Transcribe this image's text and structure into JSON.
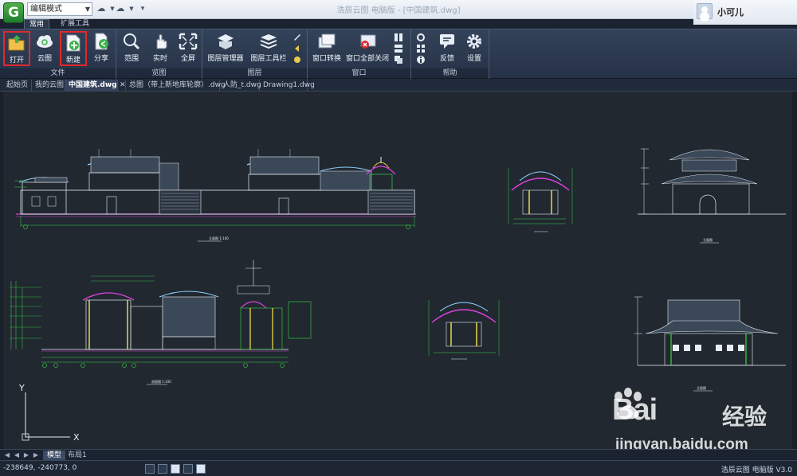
{
  "titlebar": {
    "mode_select": "编辑模式",
    "window_title": "浩辰云图 电脑版 - [中国建筑.dwg]"
  },
  "user": {
    "name": "小可儿"
  },
  "ribbon_tabs": [
    {
      "label": "常用"
    },
    {
      "label": "扩展工具"
    }
  ],
  "ribbon": {
    "groups": [
      {
        "label": "文件",
        "buttons": [
          {
            "label": "打开"
          },
          {
            "label": "云图"
          },
          {
            "label": "新建"
          },
          {
            "label": "分享"
          }
        ]
      },
      {
        "label": "览图",
        "buttons": [
          {
            "label": "范围"
          },
          {
            "label": "实时"
          },
          {
            "label": "全屏"
          }
        ]
      },
      {
        "label": "图层",
        "buttons": [
          {
            "label": "图层管理器"
          },
          {
            "label": "图层工具栏"
          }
        ]
      },
      {
        "label": "窗口",
        "buttons": [
          {
            "label": "窗口转换"
          },
          {
            "label": "窗口全部关闭"
          }
        ]
      },
      {
        "label": "帮助",
        "buttons": [
          {
            "label": "反馈"
          },
          {
            "label": "设置"
          }
        ]
      }
    ]
  },
  "doc_tabs": [
    {
      "label": "起始页"
    },
    {
      "label": "我的云图"
    },
    {
      "label": "中国建筑.dwg"
    },
    {
      "label": "总图（带上新地库轮廓）.dwg"
    },
    {
      "label": "人防_t.dwg"
    },
    {
      "label": "Drawing1.dwg"
    }
  ],
  "drawing": {
    "labels": {
      "south_elevation": "立面图 1:100",
      "section": "剖面图 1:100",
      "side_elevation_1": "立面图",
      "side_elevation_2": "立面图",
      "axis_y": "Y",
      "axis_x": "X"
    }
  },
  "layout_tabs": [
    {
      "label": "模型"
    },
    {
      "label": "布局1"
    }
  ],
  "status": {
    "coords": "-238649, -240773, 0",
    "version": "浩辰云图 电脑版 V3.0"
  },
  "watermark": {
    "brand": "Bai",
    "suffix": "经验",
    "url": "jingyan.baidu.com"
  },
  "colors": {
    "highlight": "#e0282d",
    "canvas_bg": "#212830",
    "ribbon_bg": "#2b3850"
  }
}
